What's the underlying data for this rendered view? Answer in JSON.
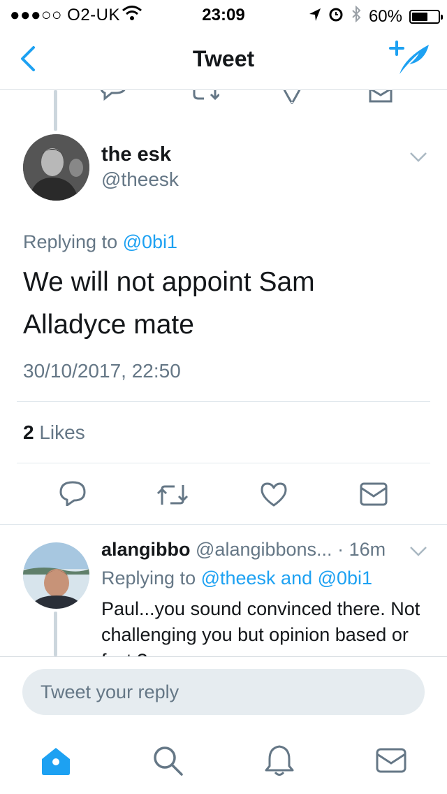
{
  "status_bar": {
    "carrier": "●●●○○ O2-UK",
    "time": "23:09",
    "battery": "60%",
    "battery_level": 0.6
  },
  "nav": {
    "title": "Tweet",
    "back_icon": "chevron-left-icon",
    "compose_icon": "compose-tweet-icon"
  },
  "tweet": {
    "name": "the esk",
    "handle": "@theesk",
    "replying_prefix": "Replying to ",
    "replying_to": "@0bi1",
    "body": "We will not appoint Sam Alladyce mate",
    "timestamp": "30/10/2017, 22:50",
    "likes_count": "2",
    "likes_label": "Likes"
  },
  "reply": {
    "name": "alangibbo",
    "handle": "@alangibbons...",
    "time": "· 16m",
    "replying_prefix": "Replying to ",
    "replying_to": "@theesk and @0bi1",
    "body": "Paul...you sound convinced there. Not challenging you but opinion based or fact ?"
  },
  "reply_box": {
    "placeholder": "Tweet your reply"
  },
  "tabbar": {
    "items": [
      "home-icon",
      "search-icon",
      "notifications-icon",
      "messages-icon"
    ]
  },
  "colors": {
    "accent": "#1da1f2",
    "secondary_text": "#657786",
    "icon_grey": "#657786"
  }
}
